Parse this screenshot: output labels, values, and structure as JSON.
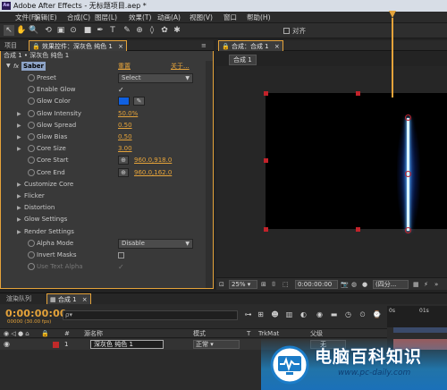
{
  "window": {
    "app_badge": "Ae",
    "title": "Adobe After Effects - 无标题项目.aep *"
  },
  "menu": [
    {
      "label": "文件(F)",
      "name": "menu-file"
    },
    {
      "label": "编辑(E)",
      "name": "menu-edit"
    },
    {
      "label": "合成(C)",
      "name": "menu-composition"
    },
    {
      "label": "图层(L)",
      "name": "menu-layer"
    },
    {
      "label": "效果(T)",
      "name": "menu-effect"
    },
    {
      "label": "动画(A)",
      "name": "menu-animation"
    },
    {
      "label": "视图(V)",
      "name": "menu-view"
    },
    {
      "label": "窗口",
      "name": "menu-window"
    },
    {
      "label": "帮助(H)",
      "name": "menu-help"
    }
  ],
  "toolbar": {
    "tools": [
      "selection-tool-icon",
      "hand-tool-icon",
      "zoom-tool-icon",
      "rotate-tool-icon",
      "camera-tool-icon",
      "pan-behind-tool-icon",
      "rectangle-tool-icon",
      "pen-tool-icon",
      "type-tool-icon",
      "brush-tool-icon",
      "clone-stamp-tool-icon",
      "eraser-tool-icon",
      "roto-brush-tool-icon",
      "puppet-tool-icon"
    ],
    "tool_glyphs": [
      "↖",
      "✋",
      "🔍",
      "⟲",
      "▣",
      "⊙",
      "■",
      "✒",
      "T",
      "✎",
      "⊕",
      "◊",
      "✿",
      "✱"
    ],
    "snap_label": "对齐"
  },
  "left_tabs": {
    "project": "项目",
    "effect_controls": "效果控件：深灰色 纯色 1"
  },
  "effect_panel": {
    "header": "合成 1 • 深灰色 纯色 1",
    "fx_badge": "fx",
    "effect_name": "Saber",
    "reset": "重置",
    "about": "关于...",
    "props": [
      {
        "label": "Preset",
        "kind": "dropdown",
        "value": "Select",
        "stopwatch": true,
        "expand": false
      },
      {
        "label": "Enable Glow",
        "kind": "check",
        "value": "✓",
        "stopwatch": true,
        "expand": false
      },
      {
        "label": "Glow Color",
        "kind": "color",
        "value": "#1060e0",
        "stopwatch": true,
        "expand": false
      },
      {
        "label": "Glow Intensity",
        "kind": "number",
        "value": "50.0%",
        "stopwatch": true,
        "expand": true
      },
      {
        "label": "Glow Spread",
        "kind": "number",
        "value": "0.50",
        "stopwatch": true,
        "expand": true
      },
      {
        "label": "Glow Bias",
        "kind": "number",
        "value": "0.50",
        "stopwatch": true,
        "expand": true
      },
      {
        "label": "Core Size",
        "kind": "number",
        "value": "3.00",
        "stopwatch": true,
        "expand": true
      },
      {
        "label": "Core Start",
        "kind": "point",
        "value": "960.0,918.0",
        "stopwatch": true,
        "expand": false
      },
      {
        "label": "Core End",
        "kind": "point",
        "value": "960.0,162.0",
        "stopwatch": true,
        "expand": false
      },
      {
        "label": "Customize Core",
        "kind": "group",
        "value": "",
        "stopwatch": false,
        "expand": true
      },
      {
        "label": "Flicker",
        "kind": "group",
        "value": "",
        "stopwatch": false,
        "expand": true
      },
      {
        "label": "Distortion",
        "kind": "group",
        "value": "",
        "stopwatch": false,
        "expand": true
      },
      {
        "label": "Glow Settings",
        "kind": "group",
        "value": "",
        "stopwatch": false,
        "expand": true
      },
      {
        "label": "Render Settings",
        "kind": "group",
        "value": "",
        "stopwatch": false,
        "expand": true
      },
      {
        "label": "Alpha Mode",
        "kind": "dropdown",
        "value": "Disable",
        "stopwatch": true,
        "expand": false
      },
      {
        "label": "Invert Masks",
        "kind": "checkbox",
        "value": "",
        "stopwatch": true,
        "expand": false
      },
      {
        "label": "Use Text Alpha",
        "kind": "check",
        "value": "✓",
        "stopwatch": true,
        "expand": false,
        "dim": true
      }
    ]
  },
  "comp_panel": {
    "tab": "合成：合成 1",
    "subtab": "合成 1",
    "zoom": "25%",
    "timecode": "0:00:00:00",
    "resolution": "(四分..."
  },
  "timeline": {
    "tabs": [
      "渲染队列",
      "合成 1"
    ],
    "current_time": "0:00:00:00",
    "fps": "00000 (30.00 fps)",
    "search_placeholder": "ρ▾",
    "ruler_ticks": [
      "0s",
      "01s"
    ],
    "headers": {
      "number": "#",
      "source_name": "源名称",
      "mode": "模式",
      "t": "T",
      "trkmat": "TrkMat",
      "parent": "父级"
    },
    "layer": {
      "number": "1",
      "name": "深灰色 纯色 1",
      "mode": "正常",
      "parent": "无",
      "label_color": "#c02a2a"
    }
  },
  "watermark": {
    "title": "电脑百科知识",
    "url": "www.pc-daily.com"
  }
}
